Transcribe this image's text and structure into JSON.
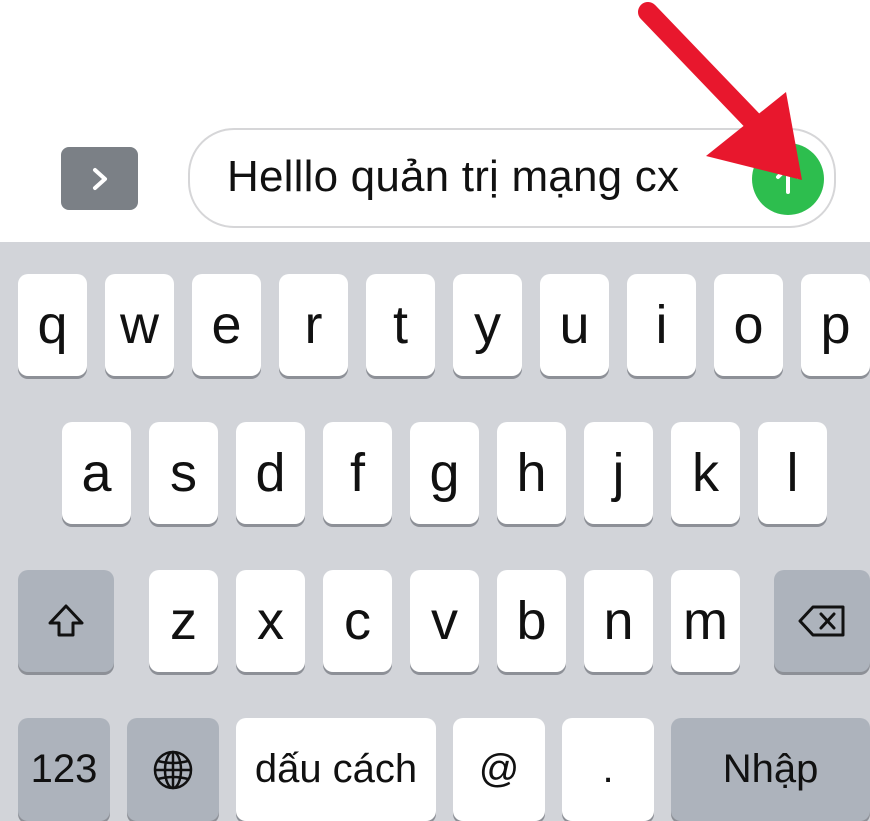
{
  "input_bar": {
    "expand_icon": "chevron-right-icon",
    "message_text": "Helllo quản trị mạng cx",
    "send_icon": "arrow-up-icon",
    "send_color": "#2dbe4e"
  },
  "annotation": {
    "arrow_color": "#e8172d"
  },
  "keyboard": {
    "row1": [
      "q",
      "w",
      "e",
      "r",
      "t",
      "y",
      "u",
      "i",
      "o",
      "p"
    ],
    "row2": [
      "a",
      "s",
      "d",
      "f",
      "g",
      "h",
      "j",
      "k",
      "l"
    ],
    "row3": [
      "z",
      "x",
      "c",
      "v",
      "b",
      "n",
      "m"
    ],
    "shift_icon": "shift-icon",
    "backspace_icon": "backspace-icon",
    "numbers_label": "123",
    "globe_icon": "globe-icon",
    "space_label": "dấu cách",
    "at_label": "@",
    "period_label": ".",
    "return_label": "Nhập"
  }
}
